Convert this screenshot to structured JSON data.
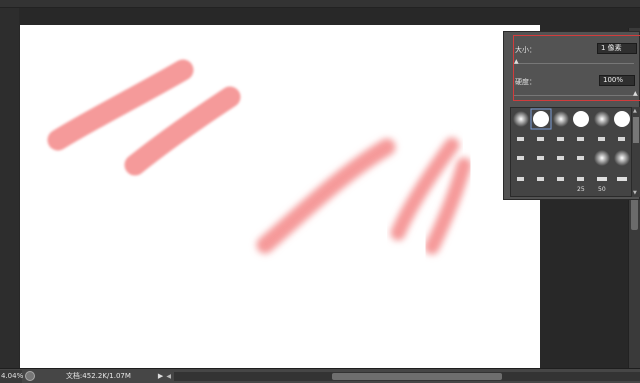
{
  "status": {
    "zoom": "4.04%",
    "doc_info": "文档:452.2K/1.07M",
    "arrow": "▶",
    "scroll_left": "◀"
  },
  "brush_panel": {
    "size_label": "大小：",
    "size_value": "1 像素",
    "hardness_label": "硬度：",
    "hardness_value": "100%",
    "size_level": 0.0,
    "hardness_level": 1.0,
    "presets": {
      "row1": [
        "soft-round",
        "hard-round-selected",
        "soft-round",
        "hard-round",
        "soft-round",
        "hard-round"
      ],
      "row2": [
        "chalk",
        "chalk",
        "chalk",
        "chalk",
        "chalk",
        "chalk"
      ],
      "row3": [
        "chalk",
        "chalk",
        "chalk",
        "chalk",
        "soft-round",
        "soft-round"
      ],
      "row4": [
        "chalk",
        "chalk",
        "chalk",
        "chalk",
        "star",
        "star"
      ],
      "sizes": [
        "25",
        "50"
      ]
    }
  },
  "canvas": {
    "stroke_color": "#f59a9a"
  },
  "colors": {
    "panel_highlight": "#d23c3c",
    "workspace": "#282828"
  }
}
